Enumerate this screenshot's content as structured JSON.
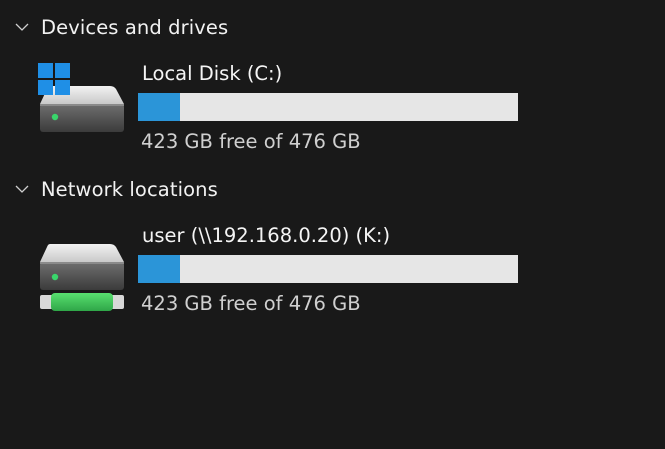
{
  "groups": [
    {
      "title": "Devices and drives",
      "drives": [
        {
          "name": "Local Disk (C:)",
          "space_text": "423 GB free of 476 GB",
          "used_fraction": 0.111,
          "icon": "windows-hard-drive-icon"
        }
      ]
    },
    {
      "title": "Network locations",
      "drives": [
        {
          "name": "user (\\\\192.168.0.20) (K:)",
          "space_text": "423 GB free of 476 GB",
          "used_fraction": 0.111,
          "icon": "network-drive-icon"
        }
      ]
    }
  ],
  "colors": {
    "background": "#191919",
    "bar_fill": "#2b95d8",
    "bar_track": "#e6e6e6",
    "status_led": "#39d66b",
    "network_connector": "#3ec75a"
  }
}
